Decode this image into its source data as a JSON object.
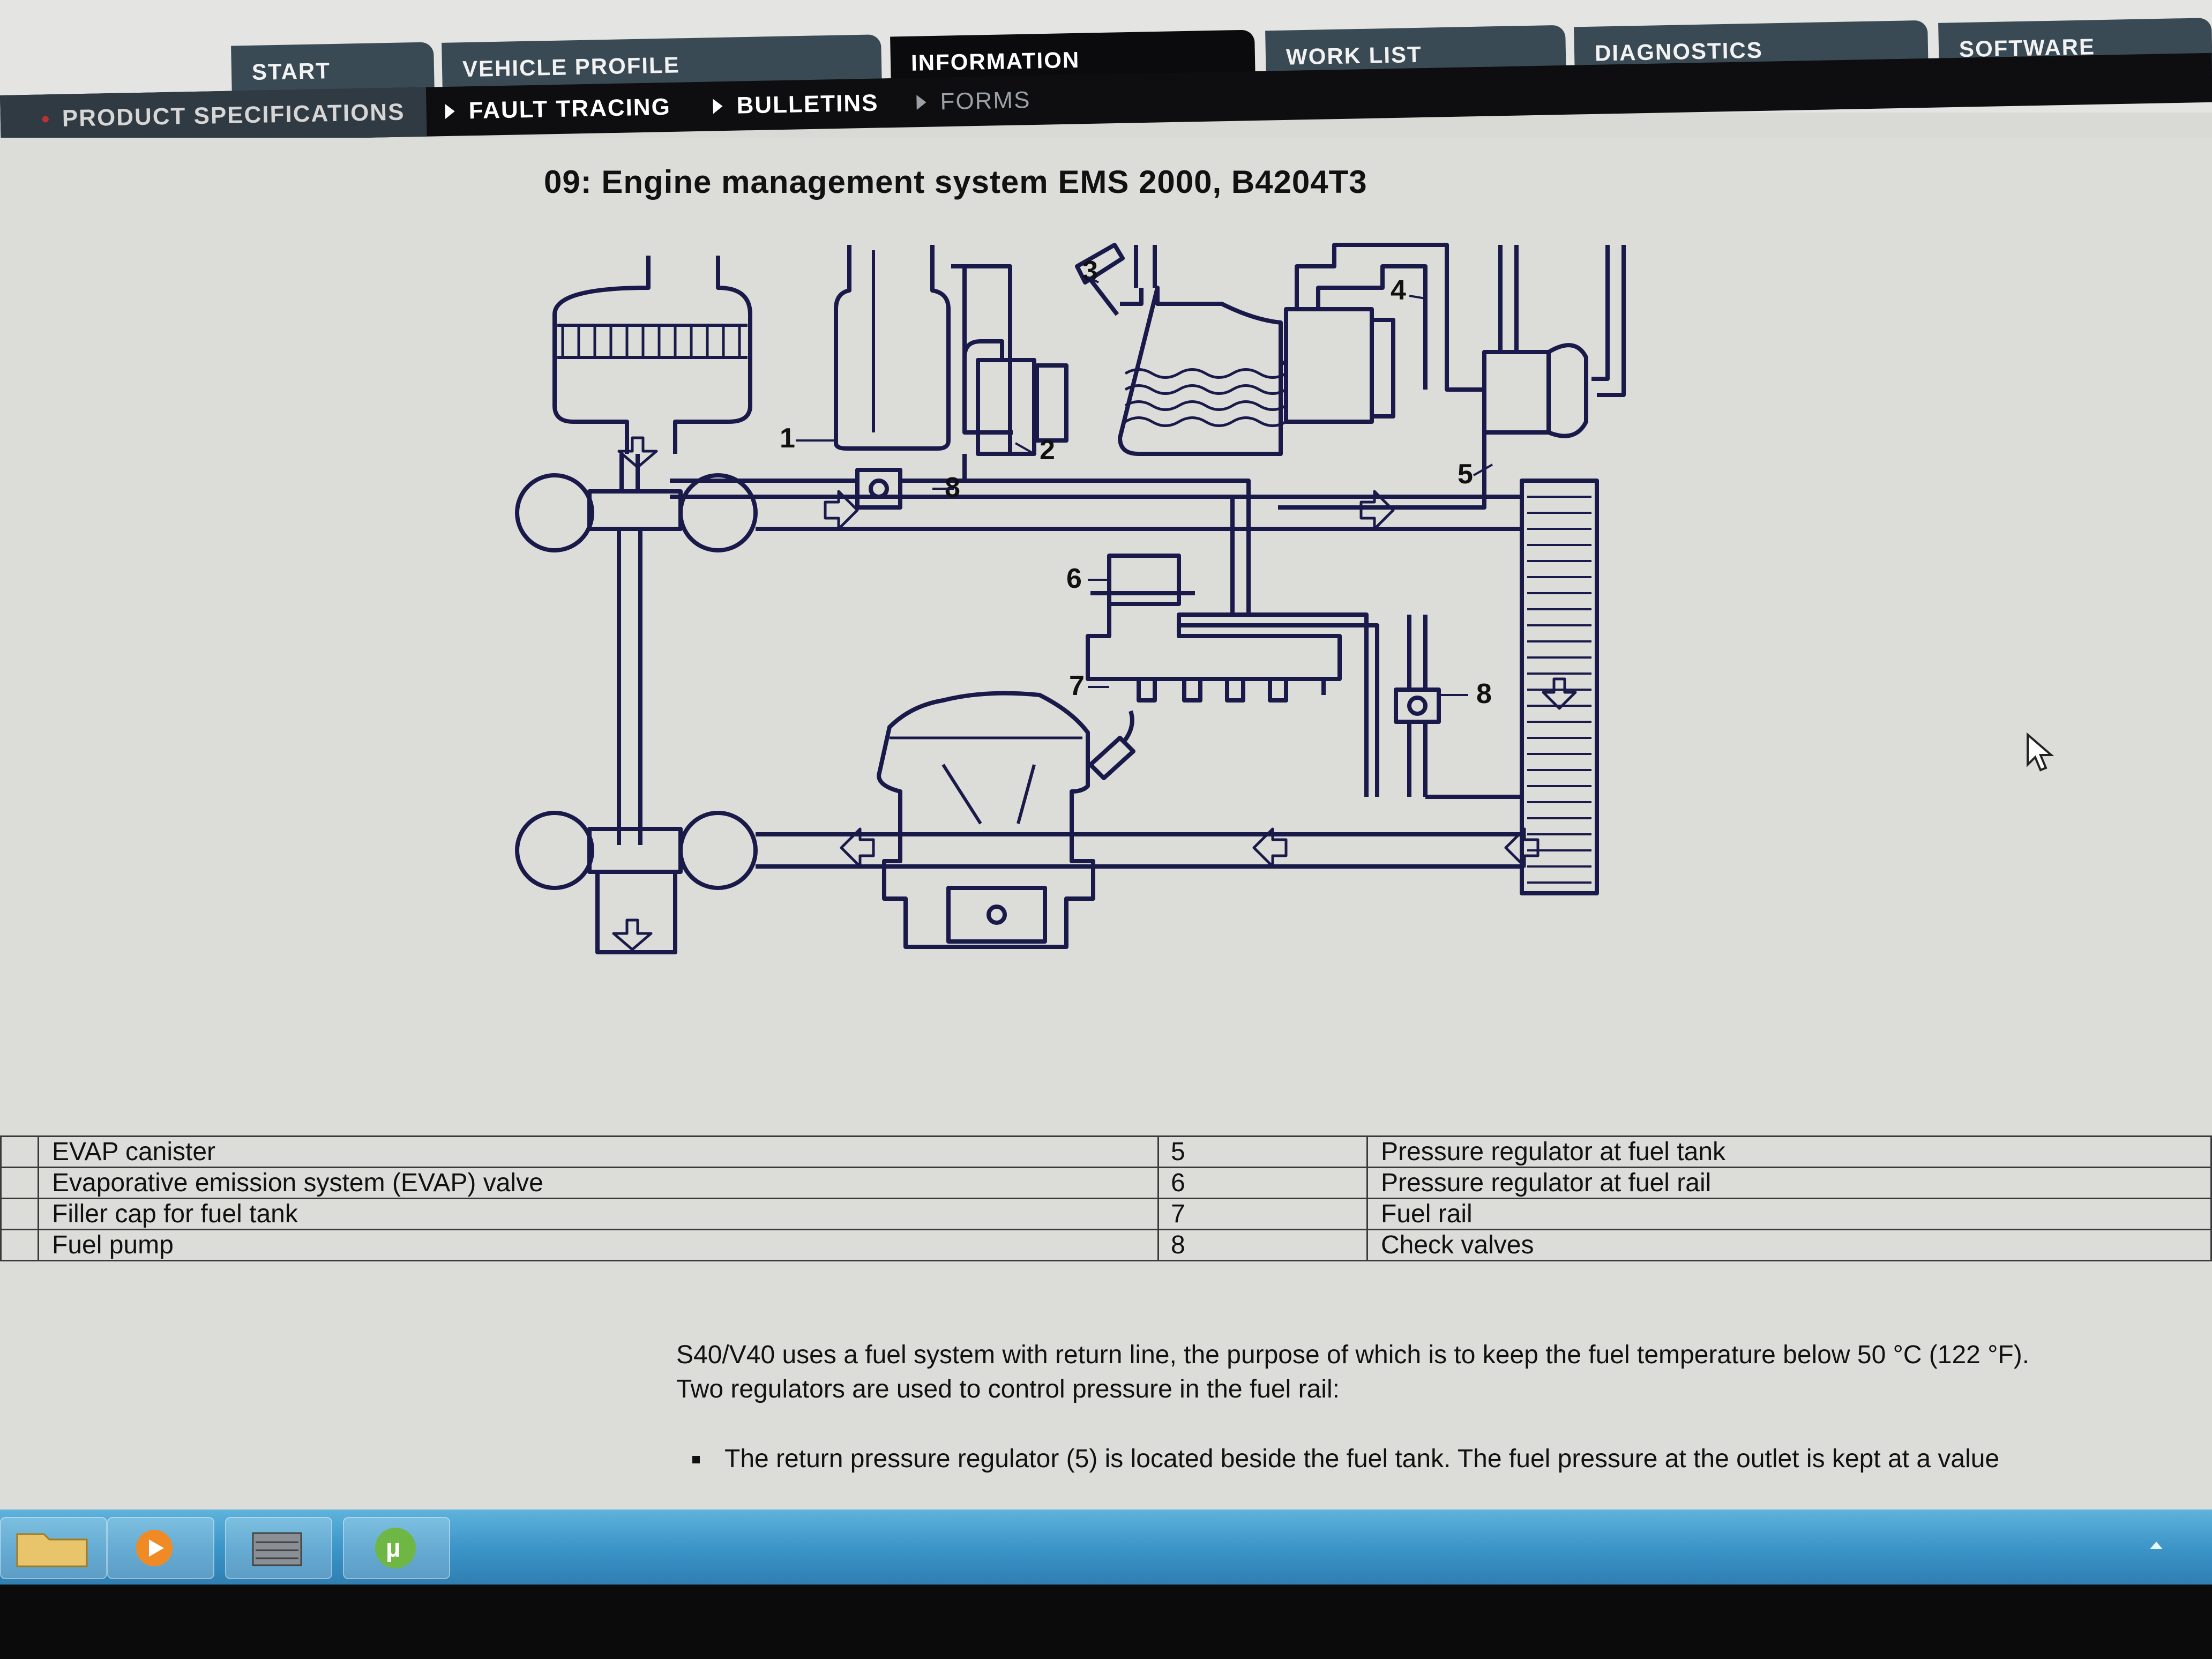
{
  "tabs": [
    {
      "label": "START"
    },
    {
      "label": "VEHICLE PROFILE"
    },
    {
      "label": "INFORMATION"
    },
    {
      "label": "WORK LIST"
    },
    {
      "label": "DIAGNOSTICS"
    },
    {
      "label": "SOFTWARE"
    }
  ],
  "subtabs": [
    {
      "label": "PRODUCT SPECIFICATIONS"
    },
    {
      "label": "FAULT TRACING"
    },
    {
      "label": "BULLETINS"
    },
    {
      "label": "FORMS"
    }
  ],
  "page_title": "09: Engine management system EMS 2000, B4204T3",
  "diagram_callouts": [
    "1",
    "2",
    "3",
    "4",
    "5",
    "6",
    "7",
    "8",
    "8"
  ],
  "legend": [
    {
      "left_num": "",
      "left": "EVAP canister",
      "right_num": "5",
      "right": "Pressure regulator at fuel tank"
    },
    {
      "left_num": "",
      "left": "Evaporative emission system (EVAP) valve",
      "right_num": "6",
      "right": "Pressure regulator at fuel rail"
    },
    {
      "left_num": "",
      "left": "Filler cap for fuel tank",
      "right_num": "7",
      "right": "Fuel rail"
    },
    {
      "left_num": "",
      "left": "Fuel pump",
      "right_num": "8",
      "right": "Check valves"
    }
  ],
  "description": {
    "line1": "S40/V40 uses a fuel system with return line, the purpose of which is to keep the fuel temperature below 50 °C (122 °F).",
    "line2": "Two regulators are used to control pressure in the fuel rail:",
    "bullet1": "The return pressure regulator (5) is located beside the fuel tank. The fuel pressure at the outlet is kept at a value"
  },
  "taskbar": {
    "items": [
      "file-explorer-icon",
      "media-player-icon",
      "app-icon",
      "utorrent-icon"
    ]
  }
}
